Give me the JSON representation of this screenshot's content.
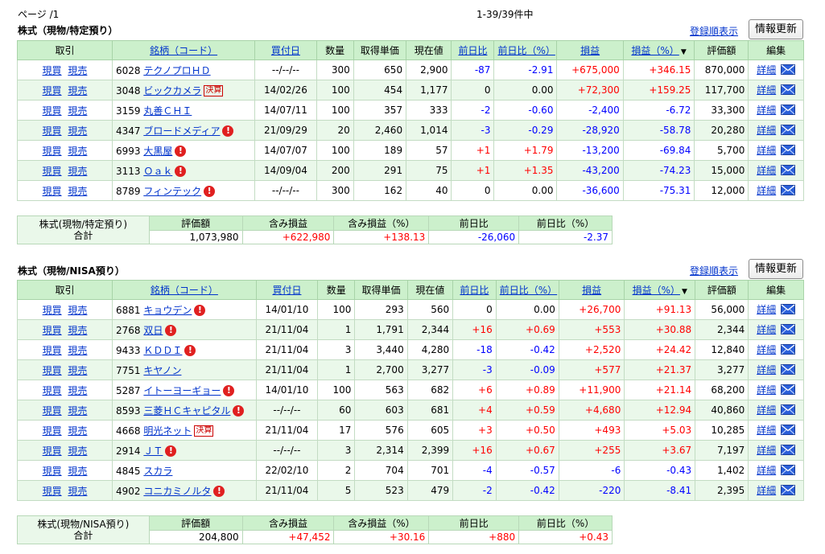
{
  "page_label": "ページ /1",
  "count_label": "1-39/39件中",
  "accent_colors": {
    "header_bg": "#ccf0cc",
    "row_alt": "#eaf8ea",
    "positive": "#ff0000",
    "negative": "#0000ff",
    "link": "#0033cc"
  },
  "sections": [
    {
      "title": "株式（現物/特定預り）",
      "sort_link": "登録順表示",
      "refresh_label": "情報更新",
      "headers": {
        "trade": "取引",
        "name": "銘柄（コード）",
        "buy_date": "買付日",
        "qty": "数量",
        "cost": "取得単価",
        "price": "現在値",
        "change": "前日比",
        "change_pct": "前日比（%）",
        "pl": "損益",
        "pl_pct": "損益（%）",
        "value": "評価額",
        "edit": "編集"
      },
      "row_actions": {
        "buy": "現買",
        "sell": "現売",
        "detail": "詳細"
      },
      "rows": [
        {
          "code": "6028",
          "name": "テクノプロＨＤ",
          "badge": "",
          "alert": false,
          "date": "--/--/--",
          "qty": "300",
          "cost": "650",
          "price": "2,900",
          "chg": "-87",
          "chg_pct": "-2.91",
          "pl": "+675,000",
          "pl_pct": "+346.15",
          "value": "870,000"
        },
        {
          "code": "3048",
          "name": "ビックカメラ",
          "badge": "決算",
          "alert": false,
          "date": "14/02/26",
          "qty": "100",
          "cost": "454",
          "price": "1,177",
          "chg": "0",
          "chg_pct": "0.00",
          "pl": "+72,300",
          "pl_pct": "+159.25",
          "value": "117,700"
        },
        {
          "code": "3159",
          "name": "丸善ＣＨＩ",
          "badge": "",
          "alert": false,
          "date": "14/07/11",
          "qty": "100",
          "cost": "357",
          "price": "333",
          "chg": "-2",
          "chg_pct": "-0.60",
          "pl": "-2,400",
          "pl_pct": "-6.72",
          "value": "33,300"
        },
        {
          "code": "4347",
          "name": "ブロードメディア",
          "badge": "",
          "alert": true,
          "date": "21/09/29",
          "qty": "20",
          "cost": "2,460",
          "price": "1,014",
          "chg": "-3",
          "chg_pct": "-0.29",
          "pl": "-28,920",
          "pl_pct": "-58.78",
          "value": "20,280"
        },
        {
          "code": "6993",
          "name": "大黒屋",
          "badge": "",
          "alert": true,
          "date": "14/07/07",
          "qty": "100",
          "cost": "189",
          "price": "57",
          "chg": "+1",
          "chg_pct": "+1.79",
          "pl": "-13,200",
          "pl_pct": "-69.84",
          "value": "5,700"
        },
        {
          "code": "3113",
          "name": "Ｏａｋ",
          "badge": "",
          "alert": true,
          "date": "14/09/04",
          "qty": "200",
          "cost": "291",
          "price": "75",
          "chg": "+1",
          "chg_pct": "+1.35",
          "pl": "-43,200",
          "pl_pct": "-74.23",
          "value": "15,000"
        },
        {
          "code": "8789",
          "name": "フィンテック",
          "badge": "",
          "alert": true,
          "date": "--/--/--",
          "qty": "300",
          "cost": "162",
          "price": "40",
          "chg": "0",
          "chg_pct": "0.00",
          "pl": "-36,600",
          "pl_pct": "-75.31",
          "value": "12,000"
        }
      ],
      "summary": {
        "label_line1": "株式(現物/特定預り)",
        "label_line2": "合計",
        "headers": [
          "評価額",
          "含み損益",
          "含み損益（%）",
          "前日比",
          "前日比（%）"
        ],
        "values": [
          "1,073,980",
          "+622,980",
          "+138.13",
          "-26,060",
          "-2.37"
        ]
      }
    },
    {
      "title": "株式（現物/NISA預り）",
      "sort_link": "登録順表示",
      "refresh_label": "情報更新",
      "headers": {
        "trade": "取引",
        "name": "銘柄（コード）",
        "buy_date": "買付日",
        "qty": "数量",
        "cost": "取得単価",
        "price": "現在値",
        "change": "前日比",
        "change_pct": "前日比（%）",
        "pl": "損益",
        "pl_pct": "損益（%）",
        "value": "評価額",
        "edit": "編集"
      },
      "row_actions": {
        "buy": "現買",
        "sell": "現売",
        "detail": "詳細"
      },
      "rows": [
        {
          "code": "6881",
          "name": "キョウデン",
          "badge": "",
          "alert": true,
          "date": "14/01/10",
          "qty": "100",
          "cost": "293",
          "price": "560",
          "chg": "0",
          "chg_pct": "0.00",
          "pl": "+26,700",
          "pl_pct": "+91.13",
          "value": "56,000"
        },
        {
          "code": "2768",
          "name": "双日",
          "badge": "",
          "alert": true,
          "date": "21/11/04",
          "qty": "1",
          "cost": "1,791",
          "price": "2,344",
          "chg": "+16",
          "chg_pct": "+0.69",
          "pl": "+553",
          "pl_pct": "+30.88",
          "value": "2,344"
        },
        {
          "code": "9433",
          "name": "ＫＤＤＩ",
          "badge": "",
          "alert": true,
          "date": "21/11/04",
          "qty": "3",
          "cost": "3,440",
          "price": "4,280",
          "chg": "-18",
          "chg_pct": "-0.42",
          "pl": "+2,520",
          "pl_pct": "+24.42",
          "value": "12,840"
        },
        {
          "code": "7751",
          "name": "キヤノン",
          "badge": "",
          "alert": false,
          "date": "21/11/04",
          "qty": "1",
          "cost": "2,700",
          "price": "3,277",
          "chg": "-3",
          "chg_pct": "-0.09",
          "pl": "+577",
          "pl_pct": "+21.37",
          "value": "3,277"
        },
        {
          "code": "5287",
          "name": "イトーヨーギョー",
          "badge": "",
          "alert": true,
          "date": "14/01/10",
          "qty": "100",
          "cost": "563",
          "price": "682",
          "chg": "+6",
          "chg_pct": "+0.89",
          "pl": "+11,900",
          "pl_pct": "+21.14",
          "value": "68,200"
        },
        {
          "code": "8593",
          "name": "三菱ＨＣキャピタル",
          "badge": "",
          "alert": true,
          "date": "--/--/--",
          "qty": "60",
          "cost": "603",
          "price": "681",
          "chg": "+4",
          "chg_pct": "+0.59",
          "pl": "+4,680",
          "pl_pct": "+12.94",
          "value": "40,860"
        },
        {
          "code": "4668",
          "name": "明光ネット",
          "badge": "決算",
          "alert": false,
          "date": "21/11/04",
          "qty": "17",
          "cost": "576",
          "price": "605",
          "chg": "+3",
          "chg_pct": "+0.50",
          "pl": "+493",
          "pl_pct": "+5.03",
          "value": "10,285"
        },
        {
          "code": "2914",
          "name": "ＪＴ",
          "badge": "",
          "alert": true,
          "date": "--/--/--",
          "qty": "3",
          "cost": "2,314",
          "price": "2,399",
          "chg": "+16",
          "chg_pct": "+0.67",
          "pl": "+255",
          "pl_pct": "+3.67",
          "value": "7,197"
        },
        {
          "code": "4845",
          "name": "スカラ",
          "badge": "",
          "alert": false,
          "date": "22/02/10",
          "qty": "2",
          "cost": "704",
          "price": "701",
          "chg": "-4",
          "chg_pct": "-0.57",
          "pl": "-6",
          "pl_pct": "-0.43",
          "value": "1,402"
        },
        {
          "code": "4902",
          "name": "コニカミノルタ",
          "badge": "",
          "alert": true,
          "date": "21/11/04",
          "qty": "5",
          "cost": "523",
          "price": "479",
          "chg": "-2",
          "chg_pct": "-0.42",
          "pl": "-220",
          "pl_pct": "-8.41",
          "value": "2,395"
        }
      ],
      "summary": {
        "label_line1": "株式(現物/NISA預り)",
        "label_line2": "合計",
        "headers": [
          "評価額",
          "含み損益",
          "含み損益（%）",
          "前日比",
          "前日比（%）"
        ],
        "values": [
          "204,800",
          "+47,452",
          "+30.16",
          "+880",
          "+0.43"
        ]
      }
    }
  ]
}
